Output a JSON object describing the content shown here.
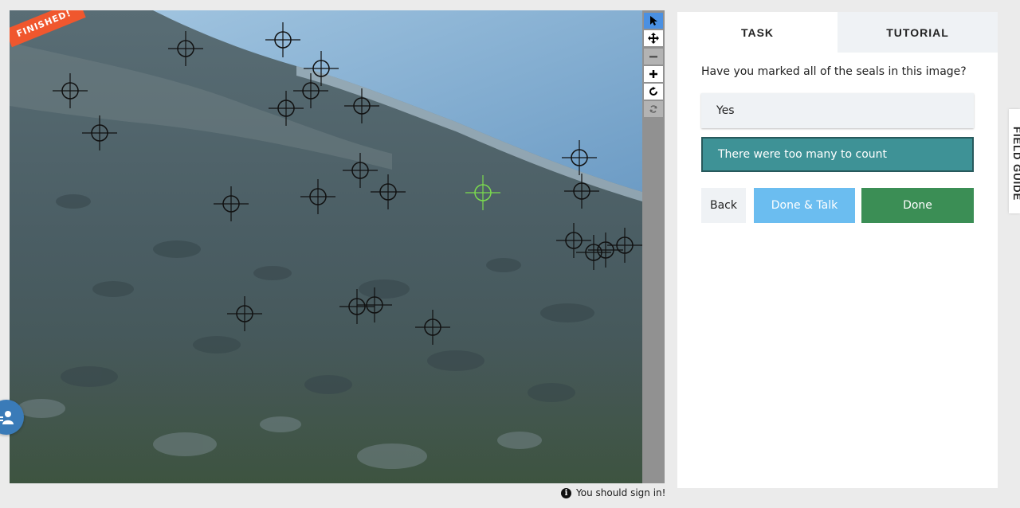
{
  "viewer": {
    "status_banner": "FINISHED!"
  },
  "panel": {
    "tabs": [
      {
        "label": "TASK",
        "active": true
      },
      {
        "label": "TUTORIAL",
        "active": false
      }
    ],
    "question": "Have you marked all of the seals in this image?",
    "answers": [
      {
        "label": "Yes",
        "selected": false
      },
      {
        "label": "There were too many to count",
        "selected": true
      }
    ],
    "buttons": {
      "back": "Back",
      "done_talk": "Done & Talk",
      "done": "Done"
    }
  },
  "footer": {
    "sign_in_notice": "You should sign in!"
  },
  "field_guide": {
    "label": "FIELD GUIDE"
  },
  "toolbar": {
    "tools": [
      "pointer-icon",
      "move-icon",
      "zoom-out-icon",
      "zoom-in-icon",
      "rotate-icon",
      "reset-icon"
    ]
  },
  "colors": {
    "finished_banner": "#f0572e",
    "selected_answer": "#3e9296",
    "done_button": "#3b8e55",
    "done_talk_button": "#6bbdf0",
    "active_mark": "#7bdc4e",
    "mark": "#111111"
  },
  "marks": {
    "count": 24,
    "active_mark_count": 1
  }
}
